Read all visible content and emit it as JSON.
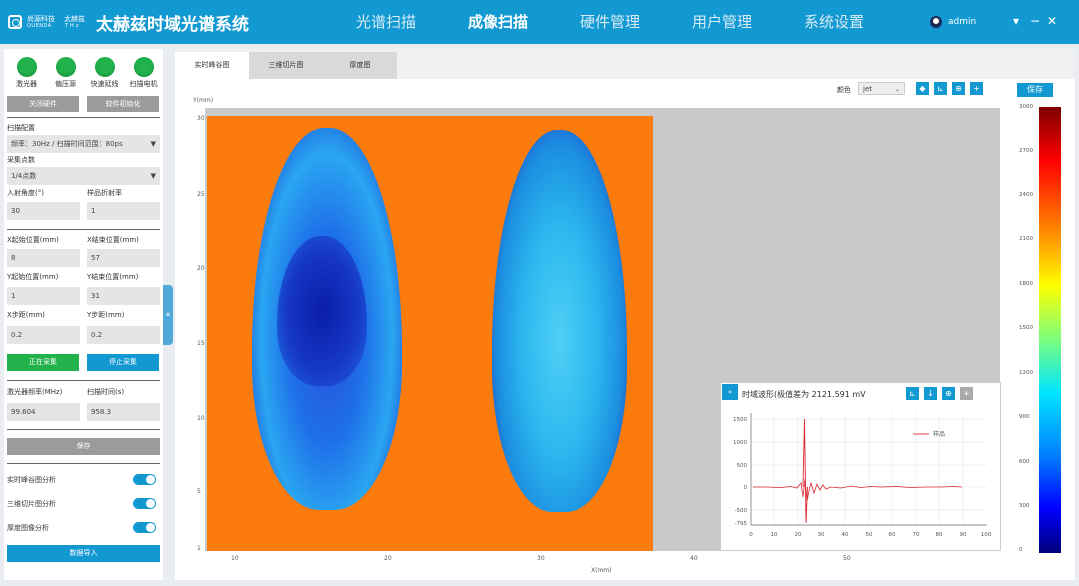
{
  "header": {
    "logo_line1": "尚源科技",
    "logo_line2": "QUENDA",
    "logo_line3": "太赫兹",
    "logo_line4": "THz",
    "title": "太赫兹时域光谱系统",
    "nav": [
      "光谱扫描",
      "成像扫描",
      "硬件管理",
      "用户管理",
      "系统设置"
    ],
    "active_nav": 1,
    "user": "admin"
  },
  "left": {
    "indicators": [
      "激光器",
      "偏压源",
      "快速延线",
      "扫描电机"
    ],
    "btn_close_hw": "关闭硬件",
    "btn_init_sw": "软件初始化",
    "scan_config_label": "扫描配置",
    "scan_config_value": "频率：30Hz / 扫描时间范围：80ps",
    "sample_points_label": "采集点数",
    "sample_points_value": "1/4点数",
    "incidence_label": "入射角度(°)",
    "incidence_value": "30",
    "refract_label": "样品折射率",
    "refract_value": "1",
    "x_start_label": "X起始位置(mm)",
    "x_start_value": "8",
    "x_end_label": "X结束位置(mm)",
    "x_end_value": "57",
    "y_start_label": "Y起始位置(mm)",
    "y_start_value": "1",
    "y_end_label": "Y结束位置(mm)",
    "y_end_value": "31",
    "x_step_label": "X步距(mm)",
    "x_step_value": "0.2",
    "y_step_label": "Y步距(mm)",
    "y_step_value": "0.2",
    "btn_collecting": "正在采集",
    "btn_stop": "停止采集",
    "laser_freq_label": "激光器频率(MHz)",
    "laser_freq_value": "99.604",
    "scan_time_label": "扫描时间(s)",
    "scan_time_value": "958.3",
    "btn_save": "保存",
    "toggles": [
      "实时峰谷图分析",
      "三维切片图分析",
      "厚度图像分析"
    ],
    "btn_export": "数据导入"
  },
  "main": {
    "tabs": [
      "实时峰谷图",
      "三维切片图",
      "厚度图"
    ],
    "active_tab": 0,
    "color_label": "颜色",
    "color_value": "jet",
    "save": "保存",
    "y_axis_label": "Y(mm)",
    "x_axis_label": "X(mm)",
    "y_ticks": [
      "30",
      "25",
      "20",
      "15",
      "10",
      "5",
      "1"
    ],
    "x_ticks": [
      "10",
      "20",
      "30",
      "40",
      "50"
    ],
    "colorbar_ticks": [
      "3000",
      "2700",
      "2400",
      "2100",
      "1800",
      "1500",
      "1200",
      "900",
      "600",
      "300",
      "0"
    ],
    "colors": {
      "accent": "#1399d2",
      "ok": "#21b24c",
      "background": "#fb7c0c"
    }
  },
  "wave": {
    "title": "时域波形(极值差为 2121.591 mV",
    "legend": "样品",
    "y_ticks": [
      "1500",
      "1000",
      "500",
      "0",
      "-500",
      "-795"
    ],
    "x_ticks": [
      "0",
      "10",
      "20",
      "30",
      "40",
      "50",
      "60",
      "70",
      "80",
      "90",
      "100"
    ]
  }
}
